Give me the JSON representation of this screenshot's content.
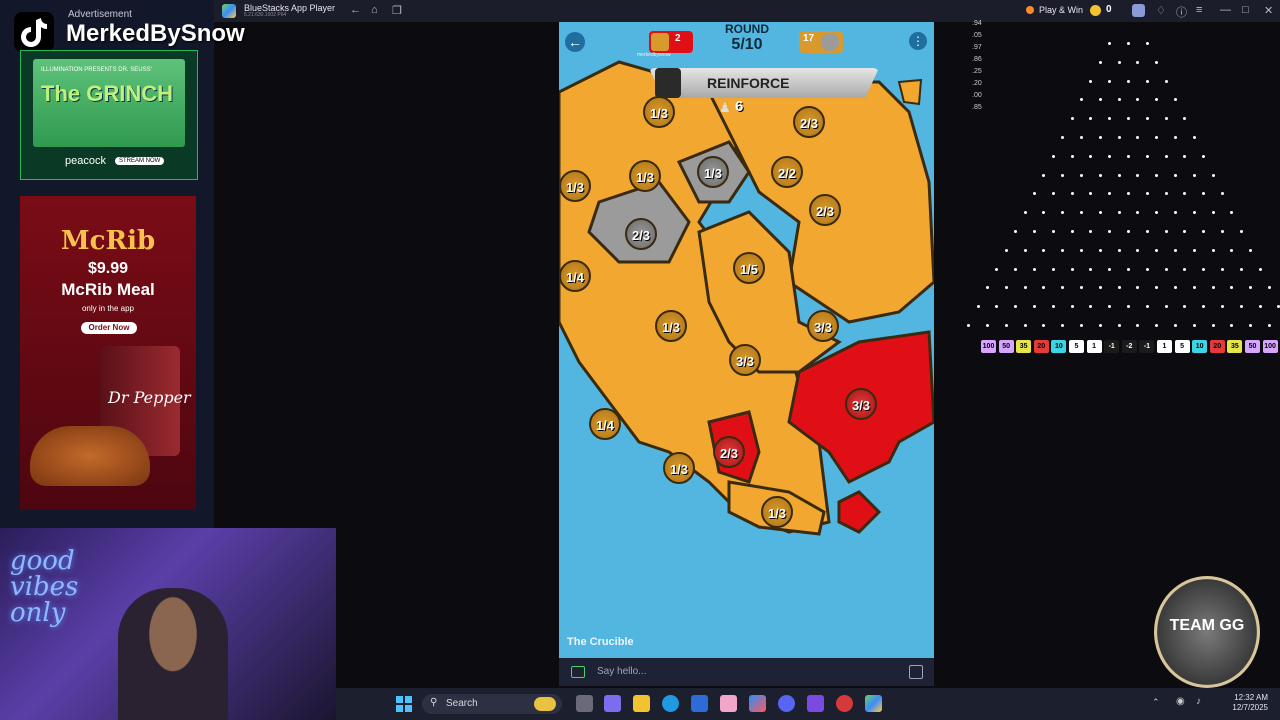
{
  "app": {
    "title": "BlueStacks App Player",
    "subtitle": "5.21.630.1002 P64"
  },
  "topbar": {
    "play_win": "Play & Win",
    "coins": "0"
  },
  "stream": {
    "ad_label": "Advertisement",
    "handle": "MerkedBySnow"
  },
  "ads": {
    "grinch": {
      "presents": "ILLUMINATION PRESENTS DR. SEUSS'",
      "title": "The GRINCH",
      "network": "peacock",
      "cta": "STREAM NOW"
    },
    "mcdonalds": {
      "brand": "McRib",
      "price": "$9.99",
      "meal": "McRib Meal",
      "only": "only in the app",
      "cta": "Order Now",
      "drink": "Dr Pepper"
    }
  },
  "webcam": {
    "neon_text": "good vibes only"
  },
  "game": {
    "round_label": "ROUND",
    "round_value": "5/10",
    "phase": "REINFORCE",
    "reinforcements": "6",
    "map_name": "The Crucible",
    "player_left_count": "2",
    "player_right_count": "17",
    "player_name": "merkedbysnow",
    "territories": [
      {
        "label": "1/3",
        "color": "yellow"
      },
      {
        "label": "2/3",
        "color": "yellow"
      },
      {
        "label": "1/3",
        "color": "yellow"
      },
      {
        "label": "1/3",
        "color": "yellow"
      },
      {
        "label": "1/3",
        "color": "gray"
      },
      {
        "label": "2/2",
        "color": "yellow"
      },
      {
        "label": "2/3",
        "color": "yellow"
      },
      {
        "label": "2/3",
        "color": "gray"
      },
      {
        "label": "1/4",
        "color": "yellow"
      },
      {
        "label": "1/5",
        "color": "yellow"
      },
      {
        "label": "1/3",
        "color": "yellow"
      },
      {
        "label": "3/3",
        "color": "yellow"
      },
      {
        "label": "3/3",
        "color": "yellow"
      },
      {
        "label": "3/3",
        "color": "red"
      },
      {
        "label": "1/4",
        "color": "yellow"
      },
      {
        "label": "2/3",
        "color": "red"
      },
      {
        "label": "1/3",
        "color": "yellow"
      },
      {
        "label": "1/3",
        "color": "yellow"
      }
    ]
  },
  "chat": {
    "placeholder": "Say hello..."
  },
  "plinko": {
    "odds": [
      ".94",
      ".05",
      ".97",
      ".86",
      ".25",
      ".20",
      ".00",
      ".85"
    ],
    "slots": [
      {
        "v": "100",
        "c": "#d6a6ff"
      },
      {
        "v": "50",
        "c": "#d6a6ff"
      },
      {
        "v": "35",
        "c": "#e6e64a"
      },
      {
        "v": "20",
        "c": "#e53a3a"
      },
      {
        "v": "10",
        "c": "#3ad6e6"
      },
      {
        "v": "5",
        "c": "#ffffff"
      },
      {
        "v": "1",
        "c": "#ffffff"
      },
      {
        "v": "-1",
        "c": "#1b1b1b"
      },
      {
        "v": "-2",
        "c": "#1b1b1b"
      },
      {
        "v": "-1",
        "c": "#1b1b1b"
      },
      {
        "v": "1",
        "c": "#ffffff"
      },
      {
        "v": "5",
        "c": "#ffffff"
      },
      {
        "v": "10",
        "c": "#3ad6e6"
      },
      {
        "v": "20",
        "c": "#e53a3a"
      },
      {
        "v": "35",
        "c": "#e6e64a"
      },
      {
        "v": "50",
        "c": "#d6a6ff"
      },
      {
        "v": "100",
        "c": "#d6a6ff"
      }
    ]
  },
  "badge": {
    "text": "TEAM GG"
  },
  "taskbar": {
    "search": "Search",
    "time": "12:32 AM",
    "date": "12/7/2025"
  }
}
